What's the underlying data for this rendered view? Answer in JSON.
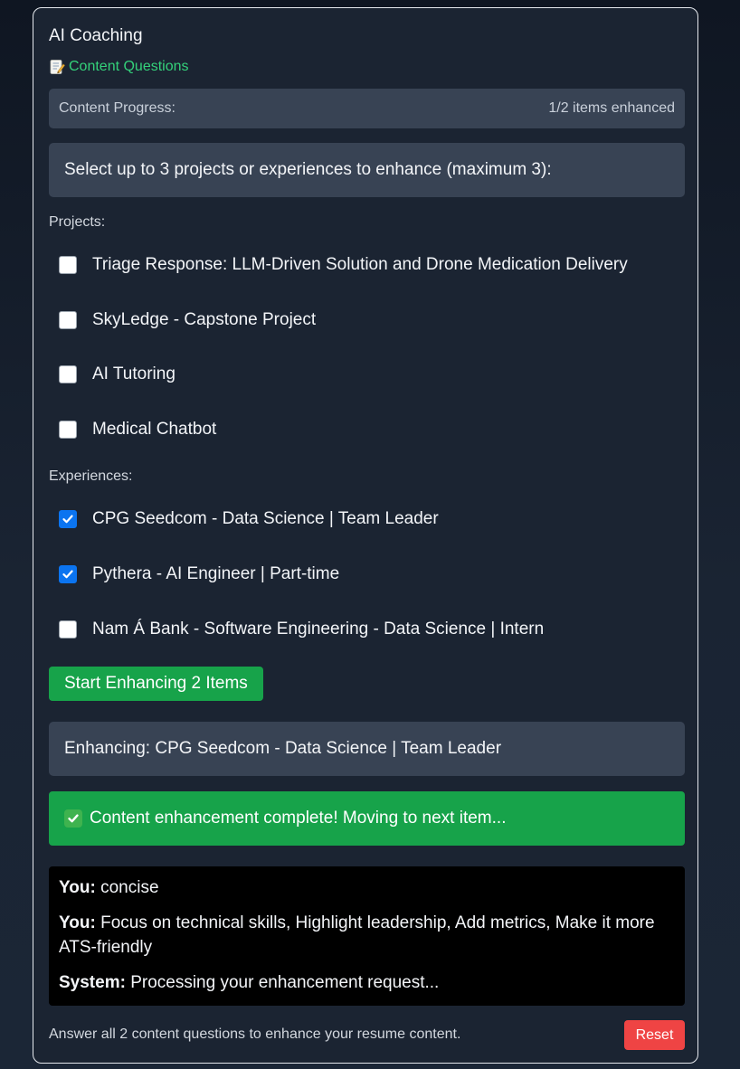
{
  "panel": {
    "title": "AI Coaching",
    "subtitle": "Content Questions",
    "subtitle_icon": "memo-icon"
  },
  "progress": {
    "label": "Content Progress:",
    "value": "1/2 items enhanced"
  },
  "instruction": "Select up to 3 projects or experiences to enhance (maximum 3):",
  "projects": {
    "label": "Projects:",
    "items": [
      {
        "label": "Triage Response: LLM-Driven Solution and Drone Medication Delivery",
        "checked": false
      },
      {
        "label": "SkyLedge - Capstone Project",
        "checked": false
      },
      {
        "label": "AI Tutoring",
        "checked": false
      },
      {
        "label": "Medical Chatbot",
        "checked": false
      }
    ]
  },
  "experiences": {
    "label": "Experiences:",
    "items": [
      {
        "label": "CPG Seedcom - Data Science | Team Leader",
        "checked": true
      },
      {
        "label": "Pythera - AI Engineer | Part-time",
        "checked": true
      },
      {
        "label": "Nam Á Bank - Software Engineering - Data Science | Intern",
        "checked": false
      }
    ]
  },
  "start_button": "Start Enhancing 2 Items",
  "enhancing": "Enhancing: CPG Seedcom - Data Science | Team Leader",
  "success_message": "Content enhancement complete! Moving to next item...",
  "chat": [
    {
      "speaker": "You:",
      "text": "concise"
    },
    {
      "speaker": "You:",
      "text": "Focus on technical skills, Highlight leadership, Add metrics, Make it more ATS-friendly"
    },
    {
      "speaker": "System:",
      "text": "Processing your enhancement request..."
    }
  ],
  "footer": {
    "text": "Answer all 2 content questions to enhance your resume content.",
    "reset_button": "Reset"
  },
  "colors": {
    "accent_green": "#17a34a",
    "subtitle_green": "#34d17a",
    "checkbox_blue": "#0b74f0",
    "reset_red": "#ef4444"
  }
}
